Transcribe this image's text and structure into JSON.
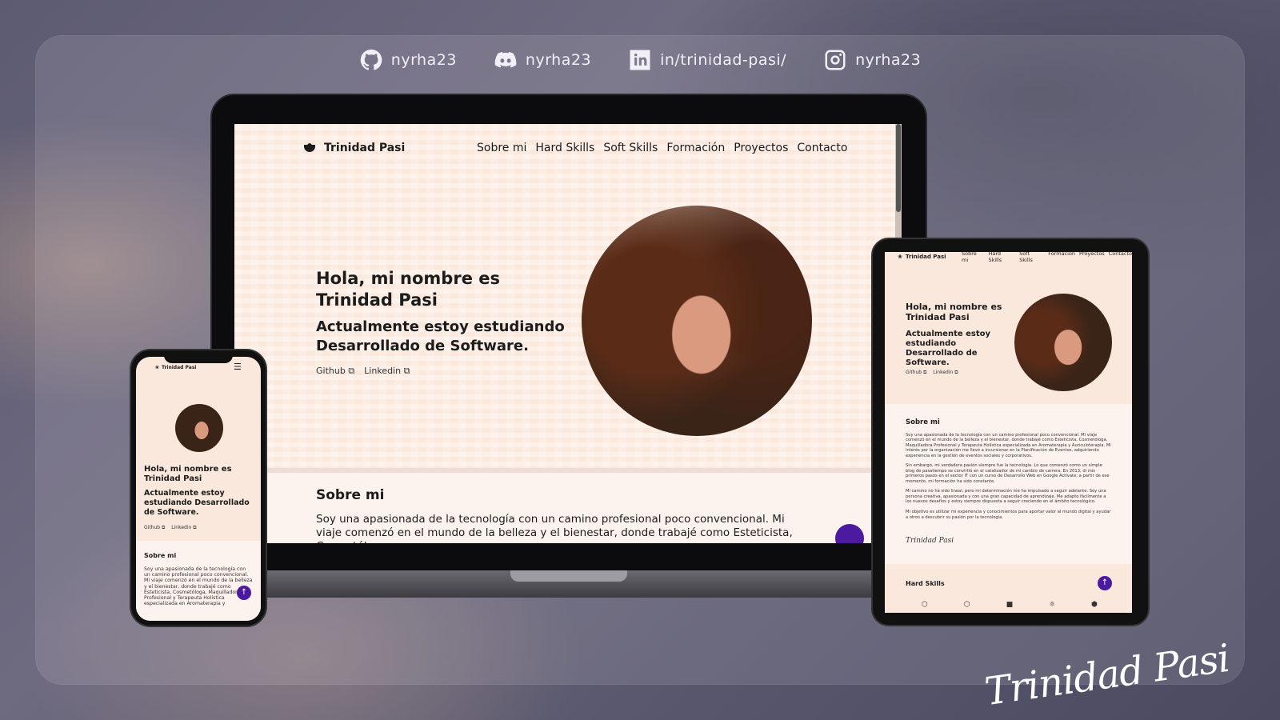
{
  "social": [
    {
      "icon": "github-icon",
      "handle": "nyrha23"
    },
    {
      "icon": "discord-icon",
      "handle": "nyrha23"
    },
    {
      "icon": "linkedin-icon",
      "handle": "in/trinidad-pasi/"
    },
    {
      "icon": "instagram-icon",
      "handle": "nyrha23"
    }
  ],
  "signature": "Trinidad Pasi",
  "site": {
    "brand": "Trinidad Pasi",
    "menu": [
      "Sobre mi",
      "Hard Skills",
      "Soft Skills",
      "Formación",
      "Proyectos",
      "Contacto"
    ],
    "hero_title": "Hola, mi nombre es Trinidad Pasi",
    "hero_subtitle": "Actualmente estoy estudiando Desarrollado de Software.",
    "link_github": "Github ⧉",
    "link_linkedin": "Linkedin ⧉",
    "about_title": "Sobre mi",
    "about_text": "Soy una apasionada de la tecnología con un camino profesional poco convencional. Mi viaje comenzó en el mundo de la belleza y el bienestar, donde trabajé como Esteticista, Cosmetóloga,",
    "hard_skills_title": "Hard Skills",
    "skill_icons": [
      "html5-icon",
      "css3-icon",
      "js-icon",
      "react-icon",
      "node-icon"
    ]
  },
  "tablet": {
    "about_text": "Soy una apasionada de la tecnología con un camino profesional poco convencional. Mi viaje comenzó en el mundo de la belleza y el bienestar, donde trabajé como Esteticista, Cosmetóloga, Maquilladora Profesional y Terapeuta Holística especializada en Aromaterapia y Auriculoterapia. Mi interés por la organización me llevó a incursionar en la Planificación de Eventos, adquiriendo experiencia en la gestión de eventos sociales y corporativos.\n\nSin embargo, mi verdadera pasión siempre fue la tecnología. Lo que comenzó como un simple blog de pasatiempo se convirtió en el catalizador de mi cambio de carrera. En 2013, di mis primeros pasos en el sector IT con un curso de Desarrollo Web en Google Activate; a partir de ese momento, mi formación ha sido constante.\n\nMi camino no ha sido lineal, pero mi determinación me ha impulsado a seguir adelante. Soy una persona creativa, apasionada y con una gran capacidad de aprendizaje. Me adapto fácilmente a los nuevos desafíos y estoy siempre dispuesta a seguir creciendo en el ámbito tecnológico.\n\nMi objetivo es utilizar mi experiencia y conocimientos para aportar valor al mundo digital y ayudar a otros a descubrir su pasión por la tecnología."
  },
  "phone": {
    "hero_subtitle": "Actualmente estoy estudiando Desarrollado de Software.",
    "about_text": "Soy una apasionada de la tecnología con un camino profesional poco convencional. Mi viaje comenzó en el mundo de la belleza y el bienestar, donde trabajé como Esteticista, Cosmetóloga, Maquilladora Profesional y Terapeuta Holística especializada en Aromaterapia y"
  },
  "colors": {
    "accent": "#4c1aa0",
    "page_bg": "#fbe8dc",
    "section_bg": "#fdf3ee"
  }
}
